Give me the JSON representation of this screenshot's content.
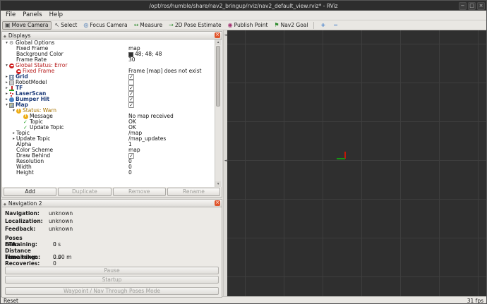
{
  "window": {
    "title": "/opt/ros/humble/share/nav2_bringup/rviz/nav2_default_view.rviz* - RViz",
    "controls": {
      "minimize": "−",
      "maximize": "□",
      "close": "×"
    }
  },
  "menubar": {
    "items": [
      "File",
      "Panels",
      "Help"
    ]
  },
  "toolbar": {
    "tools": [
      {
        "label": "Move Camera",
        "icon": "move-camera",
        "glyph": "▣",
        "color": "#4a4a4a",
        "active": true
      },
      {
        "label": "Select",
        "icon": "select-cursor",
        "glyph": "↖",
        "color": "#4a4a4a",
        "active": false
      },
      {
        "label": "Focus Camera",
        "icon": "focus-camera",
        "glyph": "◎",
        "color": "#3a6fb0",
        "active": false
      },
      {
        "label": "Measure",
        "icon": "measure-ruler",
        "glyph": "↔",
        "color": "#2e8b2e",
        "active": false
      },
      {
        "label": "2D Pose Estimate",
        "icon": "pose-estimate-arrow",
        "glyph": "→",
        "color": "#2e8b2e",
        "active": false
      },
      {
        "label": "Publish Point",
        "icon": "publish-point-pin",
        "glyph": "◉",
        "color": "#a03070",
        "active": false
      },
      {
        "label": "Nav2 Goal",
        "icon": "nav2-goal-flag",
        "glyph": "⚑",
        "color": "#2e8b2e",
        "active": false
      }
    ],
    "extra_tools": [
      {
        "name": "add-tool",
        "glyph": "+",
        "color": "#2a6fc9"
      },
      {
        "name": "remove-tool",
        "glyph": "−",
        "color": "#2a6fc9"
      }
    ]
  },
  "displays_panel": {
    "title": "Displays",
    "tree": [
      {
        "label": "Global Options",
        "indent": 0,
        "expander": "open",
        "icon": "options"
      },
      {
        "label": "Fixed Frame",
        "indent": 1,
        "value": "map"
      },
      {
        "label": "Background Color",
        "indent": 1,
        "value": "48; 48; 48",
        "swatch": "#303030"
      },
      {
        "label": "Frame Rate",
        "indent": 1,
        "value": "30"
      },
      {
        "label": "Global Status: Error",
        "indent": 0,
        "expander": "open",
        "icon": "error",
        "style": "error"
      },
      {
        "label": "Fixed Frame",
        "indent": 1,
        "icon": "error",
        "style": "error",
        "value": "Frame [map] does not exist"
      },
      {
        "label": "Grid",
        "indent": 0,
        "expander": "closed",
        "icon": "grid",
        "style": "display",
        "checkbox": true
      },
      {
        "label": "RobotModel",
        "indent": 0,
        "expander": "closed",
        "icon": "robot",
        "checkbox": false
      },
      {
        "label": "TF",
        "indent": 0,
        "expander": "closed",
        "icon": "tf",
        "style": "display",
        "checkbox": true
      },
      {
        "label": "LaserScan",
        "indent": 0,
        "expander": "closed",
        "icon": "laser",
        "style": "display",
        "checkbox": true
      },
      {
        "label": "Bumper Hit",
        "indent": 0,
        "expander": "closed",
        "icon": "bumper",
        "style": "display",
        "checkbox": true
      },
      {
        "label": "Map",
        "indent": 0,
        "expander": "open",
        "icon": "map",
        "style": "display",
        "checkbox": true
      },
      {
        "label": "Status: Warn",
        "indent": 1,
        "expander": "open",
        "icon": "warn",
        "style": "warn"
      },
      {
        "label": "Message",
        "indent": 2,
        "icon": "warn",
        "value": "No map received"
      },
      {
        "label": "Topic",
        "indent": 2,
        "icon": "ok",
        "value": "OK"
      },
      {
        "label": "Update Topic",
        "indent": 2,
        "icon": "ok",
        "value": "OK"
      },
      {
        "label": "Topic",
        "indent": 1,
        "expander": "closed",
        "value": "/map"
      },
      {
        "label": "Update Topic",
        "indent": 1,
        "expander": "closed",
        "value": "/map_updates"
      },
      {
        "label": "Alpha",
        "indent": 1,
        "value": "1"
      },
      {
        "label": "Color Scheme",
        "indent": 1,
        "value": "map"
      },
      {
        "label": "Draw Behind",
        "indent": 1,
        "checkbox": true
      },
      {
        "label": "Resolution",
        "indent": 1,
        "value": "0"
      },
      {
        "label": "Width",
        "indent": 1,
        "value": "0"
      },
      {
        "label": "Height",
        "indent": 1,
        "value": "0"
      }
    ],
    "buttons": [
      {
        "label": "Add",
        "enabled": true
      },
      {
        "label": "Duplicate",
        "enabled": false
      },
      {
        "label": "Remove",
        "enabled": false
      },
      {
        "label": "Rename",
        "enabled": false
      }
    ]
  },
  "nav2_panel": {
    "title": "Navigation 2",
    "status_rows": [
      {
        "label": "Navigation:",
        "value": "unknown"
      },
      {
        "label": "Localization:",
        "value": "unknown"
      },
      {
        "label": "Feedback:",
        "value": "unknown"
      }
    ],
    "metric_rows": [
      {
        "label": "Poses remaining:",
        "value": "0"
      },
      {
        "label": "ETA:",
        "value": "0 s"
      },
      {
        "label": "Distance remaining:",
        "value": "0.00 m"
      },
      {
        "label": "Time taken:",
        "value": "0 s"
      },
      {
        "label": "Recoveries:",
        "value": "0"
      }
    ],
    "buttons": [
      {
        "label": "Pause",
        "enabled": false
      },
      {
        "label": "Startup",
        "enabled": false
      },
      {
        "label": "Waypoint / Nav Through Poses Mode",
        "enabled": false
      }
    ]
  },
  "viewport": {
    "background_color": "#2f2f2f",
    "grid_color": "#3e3e3e",
    "axis_red_color": "#c21807",
    "axis_green_color": "#159415"
  },
  "statusbar": {
    "reset_label": "Reset",
    "fps": "31 fps"
  }
}
